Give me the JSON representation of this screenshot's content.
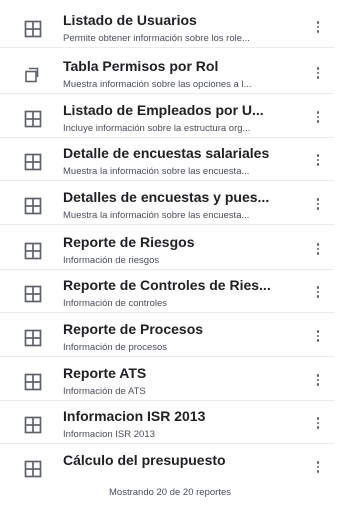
{
  "reports": [
    {
      "title": "Listado de Usuarios",
      "description": "Permite obtener información sobre los role...",
      "icon": "grid-table-icon"
    },
    {
      "title": "Tabla Permisos por Rol",
      "description": "Muestra información sobre las opciones a l...",
      "icon": "copy-icon"
    },
    {
      "title": "Listado de Empleados por U...",
      "description": "Incluye información sobre la estructura org...",
      "icon": "grid-table-icon"
    },
    {
      "title": "Detalle de encuestas salariales",
      "description": "Muestra la información sobre las encuesta...",
      "icon": "grid-table-icon"
    },
    {
      "title": "Detalles de encuestas y pues...",
      "description": "Muestra la información sobre las encuesta...",
      "icon": "grid-table-icon"
    },
    {
      "title": "Reporte de Riesgos",
      "description": "Información de riesgos",
      "icon": "grid-table-icon"
    },
    {
      "title": "Reporte de Controles de Ries...",
      "description": "Información de controles",
      "icon": "grid-table-icon"
    },
    {
      "title": "Reporte de Procesos",
      "description": "Información de procesos",
      "icon": "grid-table-icon"
    },
    {
      "title": "Reporte ATS",
      "description": "Información de ATS",
      "icon": "grid-table-icon"
    },
    {
      "title": "Informacion ISR 2013",
      "description": "Informacion ISR 2013",
      "icon": "grid-table-icon"
    },
    {
      "title": "Cálculo del presupuesto",
      "description": "",
      "icon": "grid-table-icon"
    }
  ],
  "footer": {
    "text": "Mostrando 20 de 20 reportes"
  },
  "colors": {
    "icon": "#5f6368",
    "divider": "#e9ebee",
    "title": "#202124",
    "description": "#4a4f57"
  }
}
